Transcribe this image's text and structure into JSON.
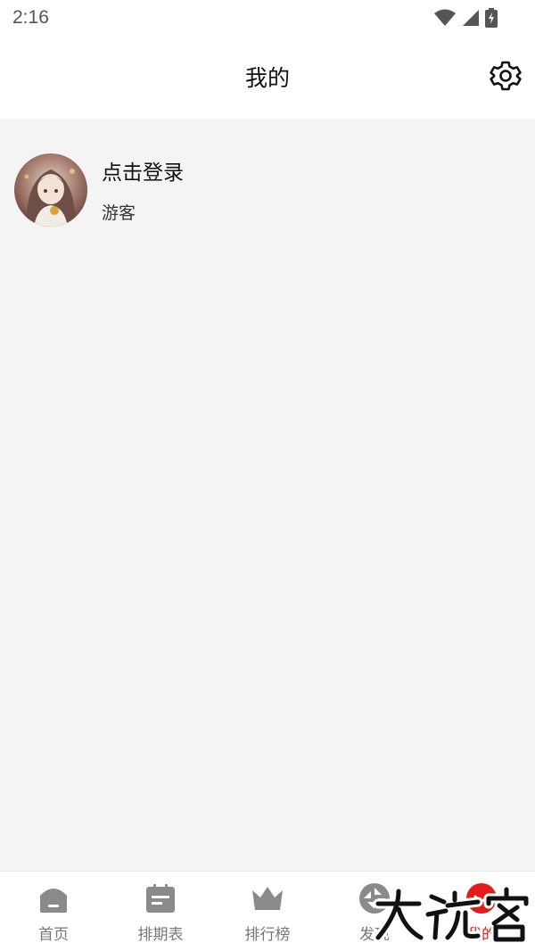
{
  "status_bar": {
    "time": "2:16",
    "icons": [
      "wifi-icon",
      "signal-icon",
      "battery-charging-icon"
    ]
  },
  "header": {
    "title": "我的",
    "settings_icon": "gear-icon"
  },
  "profile": {
    "login_label": "点击登录",
    "role": "游客",
    "avatar_icon": "avatar-anime-girl"
  },
  "bottom_nav": {
    "items": [
      {
        "label": "首页",
        "icon": "home-icon",
        "active": false
      },
      {
        "label": "排期表",
        "icon": "calendar-icon",
        "active": false
      },
      {
        "label": "排行榜",
        "icon": "crown-icon",
        "active": false
      },
      {
        "label": "发现",
        "icon": "discover-icon",
        "active": false
      },
      {
        "label": "我的",
        "icon": "profile-icon",
        "active": true
      }
    ]
  },
  "watermark": {
    "text": "大玩客"
  },
  "colors": {
    "background": "#f4f4f4",
    "accent": "#e21b1b",
    "nav_inactive": "#777777",
    "icon_inactive": "#8a8a8a"
  }
}
